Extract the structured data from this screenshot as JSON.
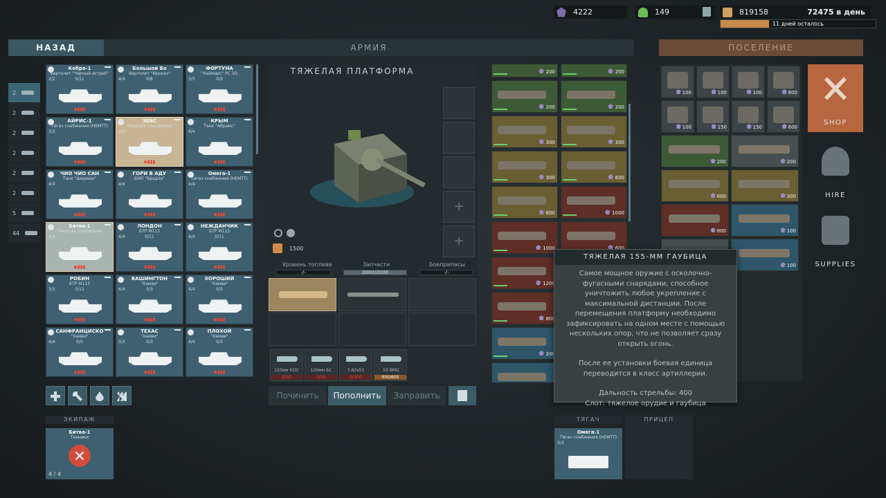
{
  "resources": {
    "gems": "4222",
    "population": "149",
    "gold": "819158",
    "per_day": "72475 в день",
    "days_left": "11 дней осталось"
  },
  "headers": {
    "back": "НАЗАД",
    "army": "АРМИЯ",
    "settlement": "ПОСЕЛЕНИЕ"
  },
  "categories": [
    "2",
    "2",
    "2",
    "2",
    "2",
    "2",
    "5",
    "44"
  ],
  "vehicles": [
    {
      "name": "Кобра-1",
      "sub": "Вертолет \"Черный ястреб\"",
      "count": "2/2",
      "mid": "0/11"
    },
    {
      "name": "Большой Бо",
      "sub": "Вертолет \"Ирокез\"",
      "count": "4/4",
      "mid": "0/8"
    },
    {
      "name": "ФОРТУНА",
      "sub": "\"Хаймарс\" РС ЗО",
      "count": "3/3",
      "mid": "0/3"
    },
    {
      "name": "АЙРИС-1",
      "sub": "Тягач снабжения (HEMTT)",
      "count": "3/3",
      "mid": ""
    },
    {
      "name": "ЗЕВС",
      "sub": "Тяжелая платформа",
      "count": "4/4",
      "mid": ""
    },
    {
      "name": "КРЫМ",
      "sub": "Танк \"Абрамс\"",
      "count": "4/4",
      "mid": ""
    },
    {
      "name": "ЧИО ЧИО САН",
      "sub": "Танк \"Шерман\"",
      "count": "4/4",
      "mid": ""
    },
    {
      "name": "ГОРИ В АДУ",
      "sub": "БМП \"Брэдли\"",
      "count": "4/4",
      "mid": ""
    },
    {
      "name": "Омега-1",
      "sub": "Тягач снабжения (HEMTT)",
      "count": "4/4",
      "mid": ""
    },
    {
      "name": "Битва-1",
      "sub": "Тяжелая платформа",
      "count": "4/4",
      "mid": ""
    },
    {
      "name": "ЛОНДОН",
      "sub": "БТР М113",
      "count": "4/4",
      "mid": "0/11"
    },
    {
      "name": "НЕЖДАНЧИК",
      "sub": "БТР М113",
      "count": "4/4",
      "mid": "0/11"
    },
    {
      "name": "РОБИН",
      "sub": "БТР М113",
      "count": "3/3",
      "mid": "0/11"
    },
    {
      "name": "ВАШИНГТОН",
      "sub": "\"Хамви\"",
      "count": "4/4",
      "mid": "0/3"
    },
    {
      "name": "ХОРОШИЙ",
      "sub": "\"Хамви\"",
      "count": "4/4",
      "mid": "0/3"
    },
    {
      "name": "САНФРАНЦИСКО",
      "sub": "\"Хамви\"",
      "count": "4/4",
      "mid": "0/5"
    },
    {
      "name": "ТЕХАС",
      "sub": "\"Хамви\"",
      "count": "3/3",
      "mid": "0/3"
    },
    {
      "name": "ПЛОХОЙ",
      "sub": "\"Хамви\"",
      "count": "4/4",
      "mid": "0/3"
    }
  ],
  "platform": {
    "title": "ТЯЖЕЛАЯ ПЛАТФОРМА",
    "cost": "1500",
    "fuel_label": "Уровень топлива",
    "fuel_value": "-/-",
    "parts_label": "Запчасти",
    "parts_value": "2000/2000",
    "ammo_label": "Боеприпасы",
    "ammo_value": "-/-"
  },
  "ammo": [
    {
      "label": "120мм КОС",
      "value": "0/10",
      "ok": false
    },
    {
      "label": "120мм БС",
      "value": "0/10",
      "ok": false
    },
    {
      "label": "7,62x51",
      "value": "0/300",
      "ok": false
    },
    {
      "label": ".50 BMG",
      "value": "600/600",
      "ok": true
    }
  ],
  "actions": {
    "repair": "Починить",
    "refill": "Пополнить",
    "refuel": "Заправить"
  },
  "weapons": [
    {
      "price": "200",
      "c": "g"
    },
    {
      "price": "200",
      "c": "g"
    },
    {
      "price": "200",
      "c": "g"
    },
    {
      "price": "200",
      "c": "g"
    },
    {
      "price": "300",
      "c": "y"
    },
    {
      "price": "300",
      "c": "y"
    },
    {
      "price": "300",
      "c": "y"
    },
    {
      "price": "600",
      "c": "y"
    },
    {
      "price": "600",
      "c": "y"
    },
    {
      "price": "1000",
      "c": "r"
    },
    {
      "price": "1000",
      "c": "r"
    },
    {
      "price": "600",
      "c": "r"
    },
    {
      "price": "1200",
      "c": "r"
    },
    {
      "price": "",
      "c": "r"
    },
    {
      "price": "800",
      "c": "r"
    },
    {
      "price": "",
      "c": "r"
    },
    {
      "price": "200",
      "c": "b"
    },
    {
      "price": "",
      "c": "b"
    },
    {
      "price": "",
      "c": "b"
    },
    {
      "price": "",
      "c": "b"
    }
  ],
  "tooltip": {
    "title": "ТЯЖЕЛАЯ 155-ММ ГАУБИЦА",
    "p1": "Самое мощное оружие с осколочно-фугасными снарядами, способное уничтожить любое укрепление с максимальной дистанции. После перемещения платформу необходимо зафиксировать на одном месте с помощью нескольких опор, что не позволяет сразу открыть огонь.",
    "p2": "После ее установки боевая единица переводится в класс артиллерии.",
    "p3": "Дальность стрельбы: 400",
    "p4": "Слот: тяжелое орудие и гаубица"
  },
  "storage_small": [
    "100",
    "100",
    "100",
    "800",
    "100",
    "150",
    "150",
    "600"
  ],
  "storage_wide": [
    {
      "price": "200",
      "c": "g"
    },
    {
      "price": "200",
      "c": "t"
    },
    {
      "price": "600",
      "c": "y"
    },
    {
      "price": "300",
      "c": "y"
    },
    {
      "price": "800",
      "c": "r"
    },
    {
      "price": "100",
      "c": "b"
    },
    {
      "price": "",
      "c": "t"
    },
    {
      "price": "100",
      "c": "b"
    }
  ],
  "nav": {
    "shop": "SHOP",
    "hire": "HIRE",
    "supplies": "SUPPLIES"
  },
  "crew": {
    "header": "ЭКИПАЖ",
    "name": "Битва-1",
    "sub": "Техники",
    "count": "4 / 4"
  },
  "tow": {
    "header": "ТЯГАЧ",
    "trailer_header": "ПРИЦЕП",
    "name": "Омега-1",
    "sub": "Тягач снабжения (HEMTT)",
    "count": "3/3"
  }
}
